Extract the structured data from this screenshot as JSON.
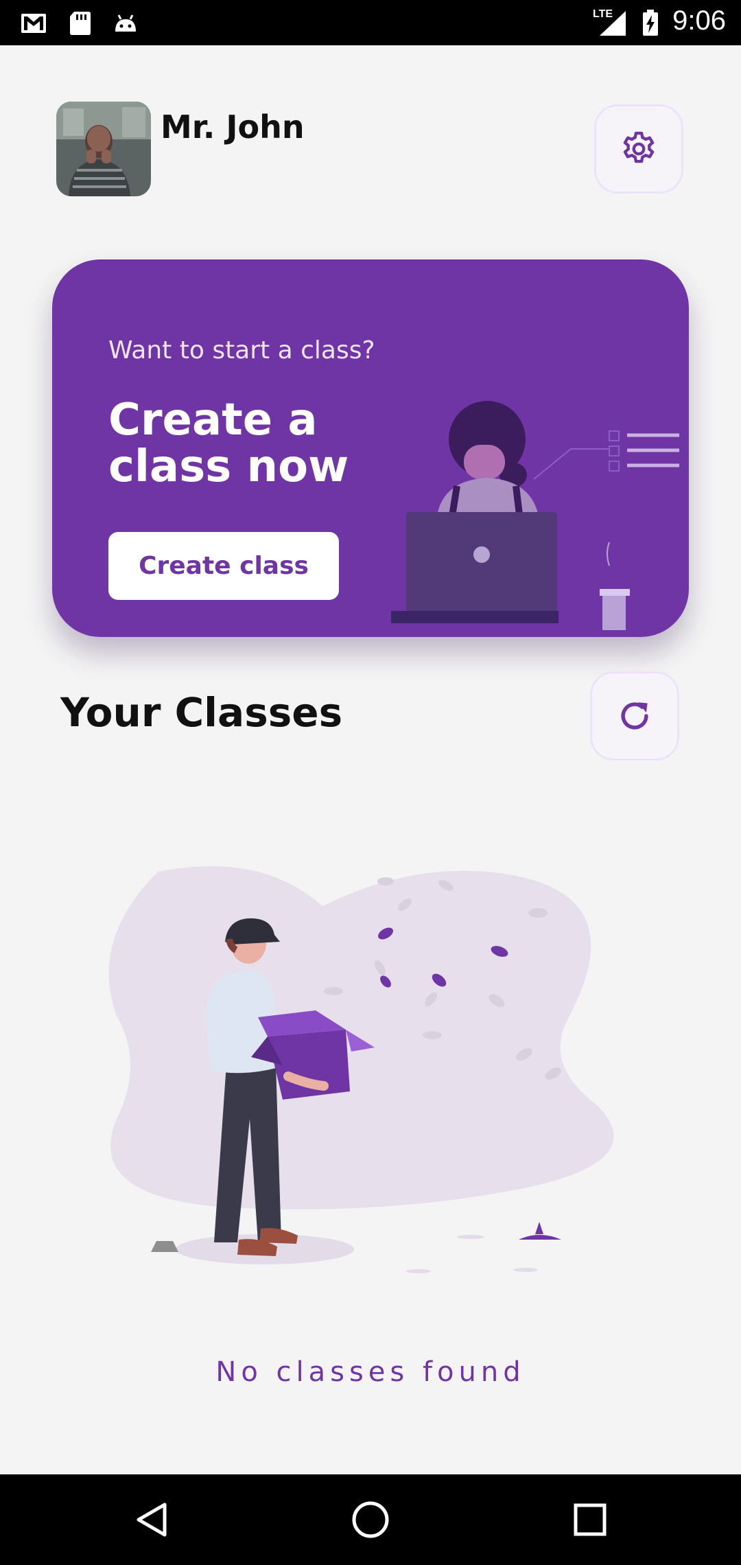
{
  "status_bar": {
    "time": "9:06",
    "network": "LTE",
    "icons": [
      "gmail-icon",
      "sd-card-icon",
      "android-icon",
      "signal-icon",
      "battery-charging-icon"
    ]
  },
  "header": {
    "user_name": "Mr. John",
    "settings_icon": "gear-icon"
  },
  "hero": {
    "subtitle": "Want to start a class?",
    "title": "Create a class now",
    "button_label": "Create class",
    "accent_color": "#6f35a5"
  },
  "classes": {
    "title": "Your Classes",
    "refresh_icon": "refresh-icon",
    "empty_message": "No classes found"
  },
  "nav_bar": {
    "icons": [
      "back-icon",
      "home-icon",
      "recents-icon"
    ]
  }
}
